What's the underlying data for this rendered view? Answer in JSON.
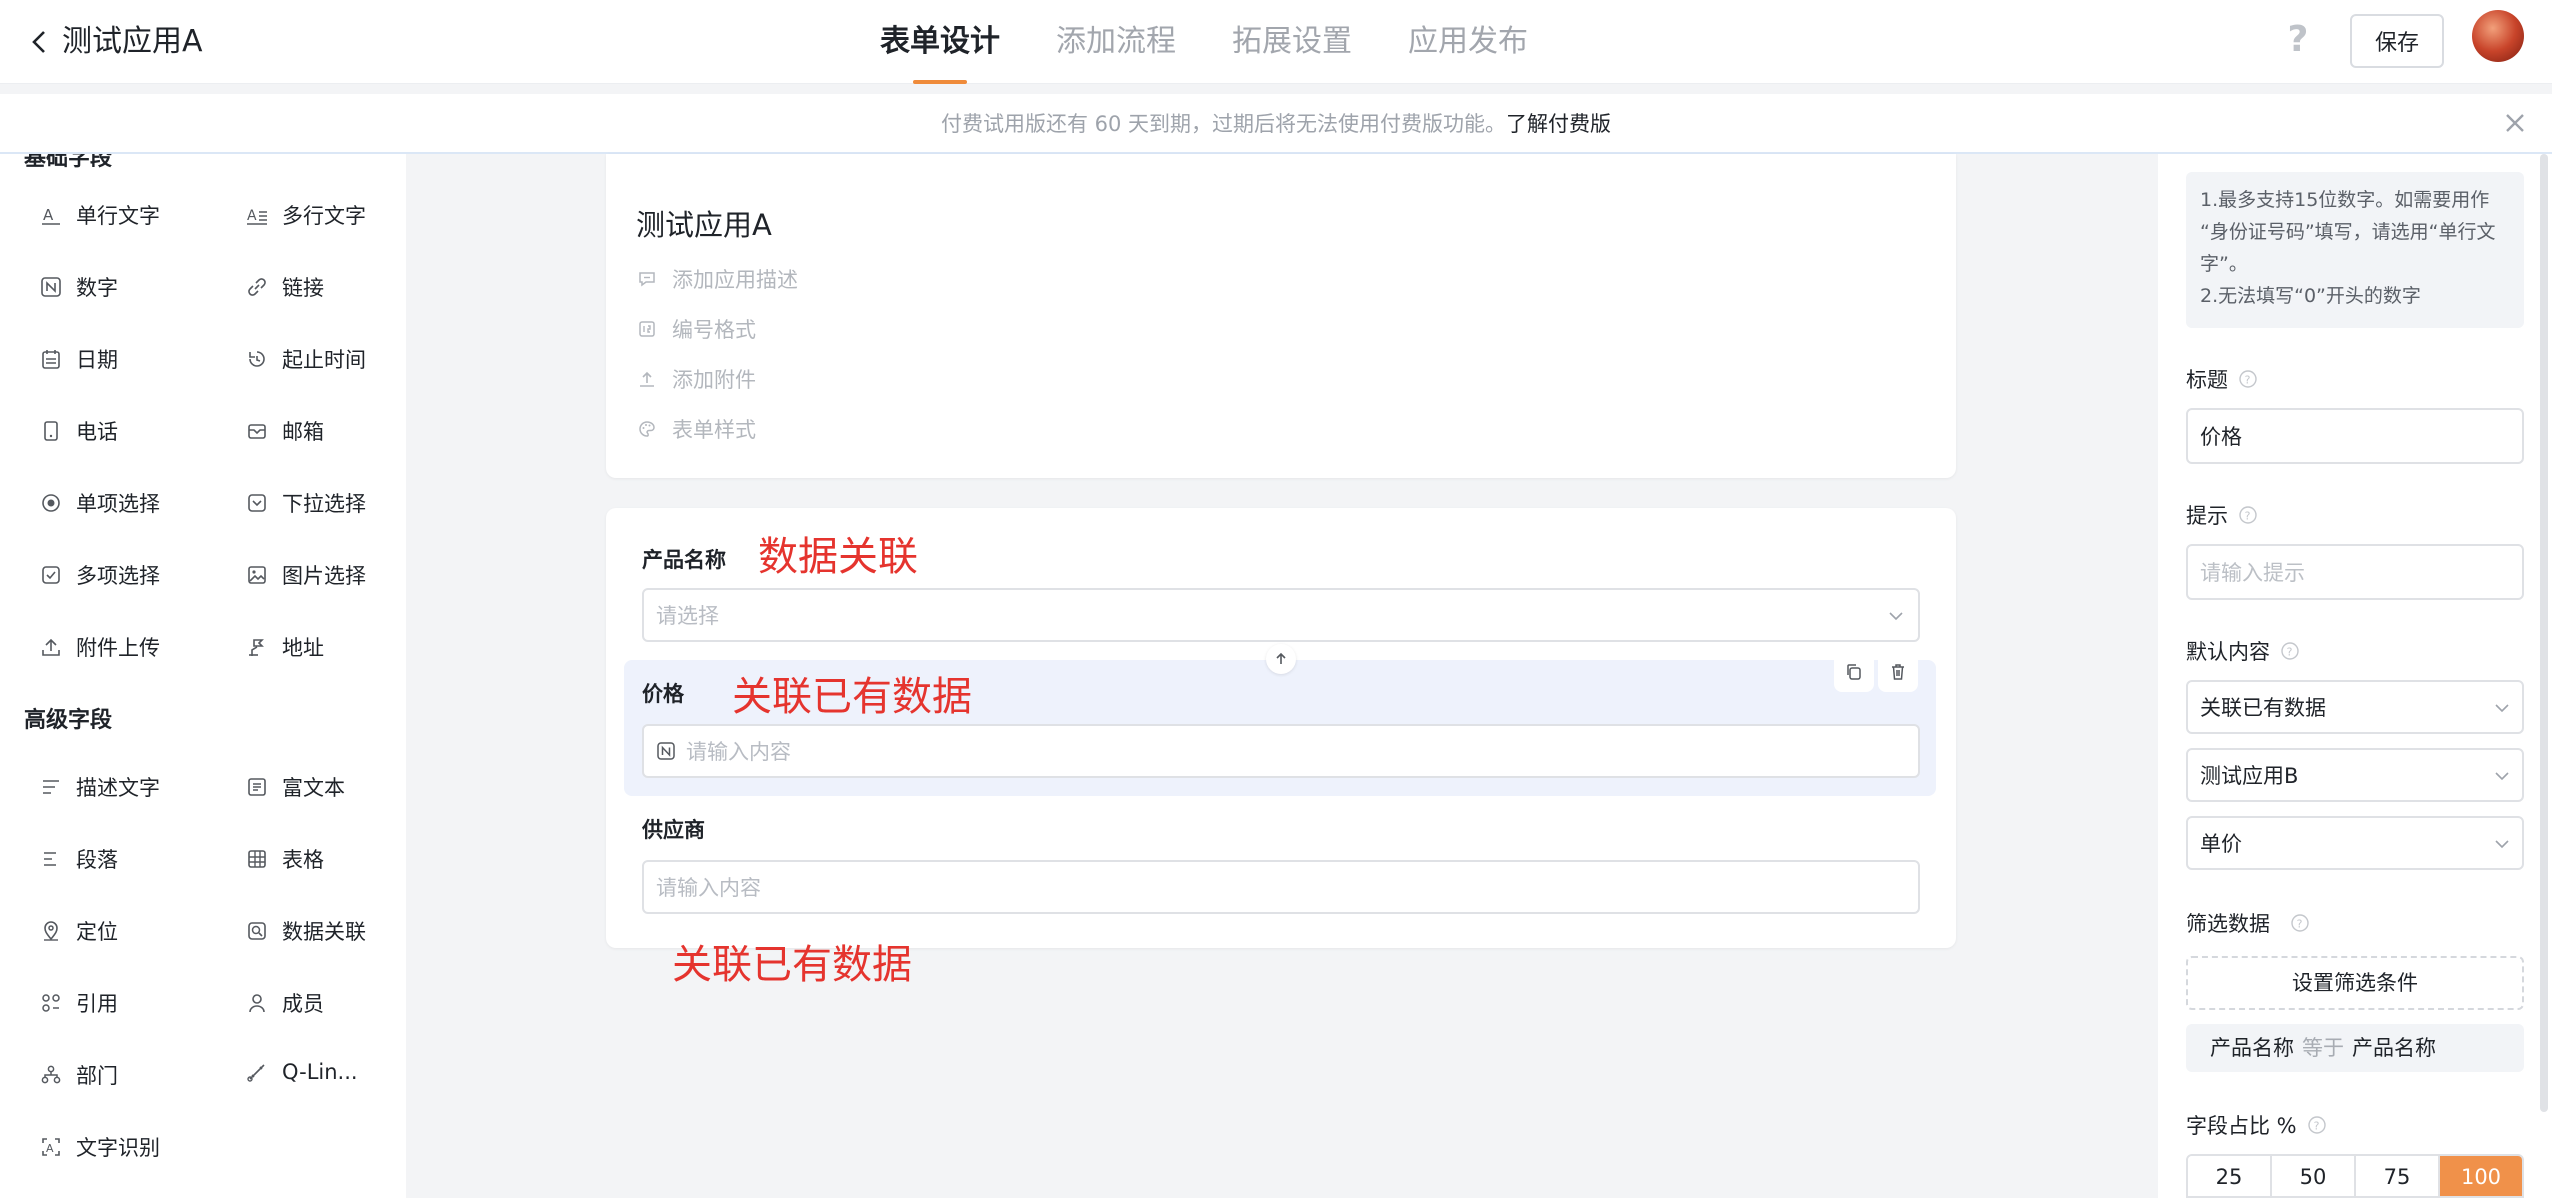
{
  "header": {
    "app_title": "测试应用A",
    "tabs": [
      "表单设计",
      "添加流程",
      "拓展设置",
      "应用发布"
    ],
    "help": "?",
    "save_label": "保存"
  },
  "banner": {
    "text": "付费试用版还有 60 天到期，过期后将无法使用付费版功能。",
    "link": "了解付费版"
  },
  "left": {
    "basic_head": "基础字段",
    "basic": [
      {
        "label": "单行文字",
        "icon": "text-a-icon"
      },
      {
        "label": "多行文字",
        "icon": "multiline-text-icon"
      },
      {
        "label": "数字",
        "icon": "number-icon"
      },
      {
        "label": "链接",
        "icon": "link-icon"
      },
      {
        "label": "日期",
        "icon": "calendar-icon"
      },
      {
        "label": "起止时间",
        "icon": "time-range-icon"
      },
      {
        "label": "电话",
        "icon": "phone-icon"
      },
      {
        "label": "邮箱",
        "icon": "mail-icon"
      },
      {
        "label": "单项选择",
        "icon": "radio-icon"
      },
      {
        "label": "下拉选择",
        "icon": "dropdown-icon"
      },
      {
        "label": "多项选择",
        "icon": "checkbox-icon"
      },
      {
        "label": "图片选择",
        "icon": "image-icon"
      },
      {
        "label": "附件上传",
        "icon": "upload-icon"
      },
      {
        "label": "地址",
        "icon": "address-icon"
      }
    ],
    "advanced_head": "高级字段",
    "advanced": [
      {
        "label": "描述文字",
        "icon": "description-icon"
      },
      {
        "label": "富文本",
        "icon": "rich-text-icon"
      },
      {
        "label": "段落",
        "icon": "paragraph-icon"
      },
      {
        "label": "表格",
        "icon": "table-icon"
      },
      {
        "label": "定位",
        "icon": "location-icon"
      },
      {
        "label": "数据关联",
        "icon": "data-link-icon"
      },
      {
        "label": "引用",
        "icon": "reference-icon"
      },
      {
        "label": "成员",
        "icon": "member-icon"
      },
      {
        "label": "部门",
        "icon": "department-icon"
      },
      {
        "label": "Q-Lin...",
        "icon": "qlink-icon"
      },
      {
        "label": "文字识别",
        "icon": "ocr-icon"
      }
    ]
  },
  "form": {
    "title": "测试应用A",
    "meta": [
      "添加应用描述",
      "编号格式",
      "添加附件",
      "表单样式"
    ],
    "fields": [
      {
        "label": "产品名称",
        "placeholder": "请选择",
        "note": "数据关联"
      },
      {
        "label": "价格",
        "placeholder": "请输入内容",
        "note": "关联已有数据"
      },
      {
        "label": "供应商",
        "placeholder": "请输入内容",
        "note": "关联已有数据"
      }
    ]
  },
  "right": {
    "tip_lines": [
      "1.最多支持15位数字。如需要用作",
      "“身份证号码”填写，请选用“单行文",
      "字”。",
      "2.无法填写“0”开头的数字"
    ],
    "title_label": "标题",
    "title_value": "价格",
    "hint_label": "提示",
    "hint_placeholder": "请输入提示",
    "default_label": "默认内容",
    "default_selects": [
      "关联已有数据",
      "测试应用B",
      "单价"
    ],
    "filter_label": "筛选数据",
    "filter_button": "设置筛选条件",
    "condition": {
      "left": "产品名称",
      "op": "等于",
      "right": "产品名称"
    },
    "ratio_label": "字段占比 %",
    "ratios": [
      "25",
      "50",
      "75",
      "100"
    ],
    "ratio_selected": "100"
  },
  "colors": {
    "accent": "#ef8b3a",
    "note_red": "#e5342e",
    "selected_bg": "#eef2fc"
  }
}
